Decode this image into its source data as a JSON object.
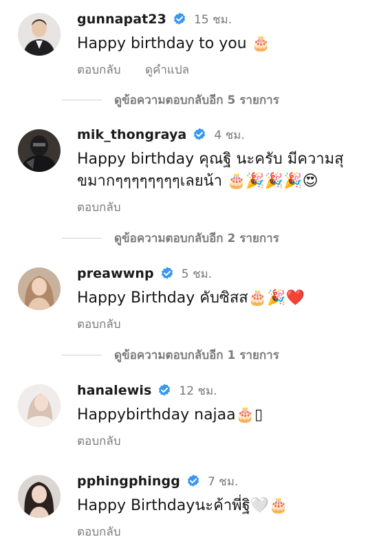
{
  "comments": [
    {
      "username": "gunnapat23",
      "time": "15 ชม.",
      "text": "Happy birthday to you 🎂",
      "reply_label": "ตอบกลับ",
      "translate_label": "ดูคำแปล",
      "more_replies": "ดูข้อความตอบกลับอีก 5 รายการ"
    },
    {
      "username": "mik_thongraya",
      "time": "4 ชม.",
      "text": "Happy birthday คุณฐิ นะครับ มีความสุขมากๆๆๆๆๆๆๆๆเลยน้า 🎂🎉🎉🎉😍",
      "reply_label": "ตอบกลับ",
      "more_replies": "ดูข้อความตอบกลับอีก 2 รายการ"
    },
    {
      "username": "preawwnp",
      "time": "5 ชม.",
      "text": "Happy Birthday คับซิสส🎂🎉❤️",
      "reply_label": "ตอบกลับ",
      "more_replies": "ดูข้อความตอบกลับอีก 1 รายการ"
    },
    {
      "username": "hanalewis",
      "time": "12 ชม.",
      "text": "Happybirthday najaa🎂▯",
      "reply_label": "ตอบกลับ"
    },
    {
      "username": "pphingphingg",
      "time": "7 ชม.",
      "text": "Happy Birthdayนะค้าพี่ฐิ🤍🎂",
      "reply_label": "ตอบกลับ"
    }
  ],
  "colors": {
    "verified": "#3897f0",
    "muted": "#7b7b7b",
    "text": "#161616",
    "heart": "#e0245e"
  },
  "icons": {
    "verified": "verified-badge-icon"
  }
}
